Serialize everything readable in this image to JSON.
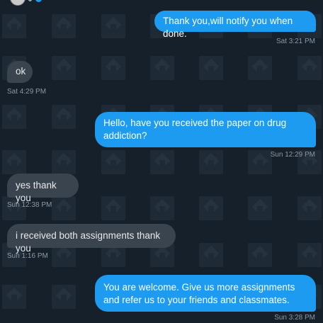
{
  "messages": [
    {
      "direction": "sent",
      "text": "Thank you,will notify you when done.",
      "time": "Sat 3:21 PM"
    },
    {
      "direction": "received",
      "text": "ok",
      "time": "Sat 4:29 PM"
    },
    {
      "direction": "sent",
      "text": "Hello, have you received the paper on drug addiction?",
      "time": "Sun 12:29 PM"
    },
    {
      "direction": "received",
      "text": "yes thank you",
      "time": "Sun 12:38 PM"
    },
    {
      "direction": "received",
      "text": "i received both assignments thank you",
      "time": "Sun 1:16 PM"
    },
    {
      "direction": "sent",
      "text": "You are welcome. Give us more assignments and refer us to your friends and classmates.",
      "time": "Sun 3:28 PM"
    }
  ],
  "colors": {
    "background": "#15202b",
    "sent_bubble": "#1d9bf0",
    "received_bubble": "#3a444f",
    "timestamp": "#8b98a5"
  }
}
